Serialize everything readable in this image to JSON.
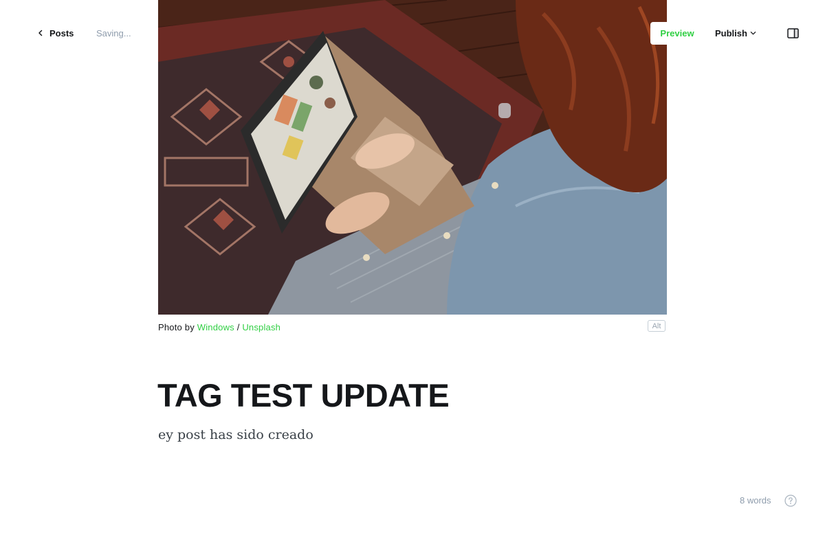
{
  "header": {
    "back_label": "Posts",
    "save_status": "Saving...",
    "preview_label": "Preview",
    "publish_label": "Publish",
    "icons": {
      "back": "chevron-left-icon",
      "publish_dropdown": "chevron-down-icon",
      "sidebar": "sidebar-toggle-icon"
    }
  },
  "feature_image": {
    "caption_prefix": "Photo by",
    "author": "Windows",
    "separator": "/",
    "source": "Unsplash",
    "alt_label": "Alt"
  },
  "post": {
    "title": "TAG TEST UPDATE",
    "body": "ey post has sido creado"
  },
  "footer": {
    "word_count": "8 words",
    "help_icon": "question-circle-icon"
  },
  "colors": {
    "accent": "#30cf43",
    "text": "#15171a",
    "muted": "#8e9cac"
  }
}
